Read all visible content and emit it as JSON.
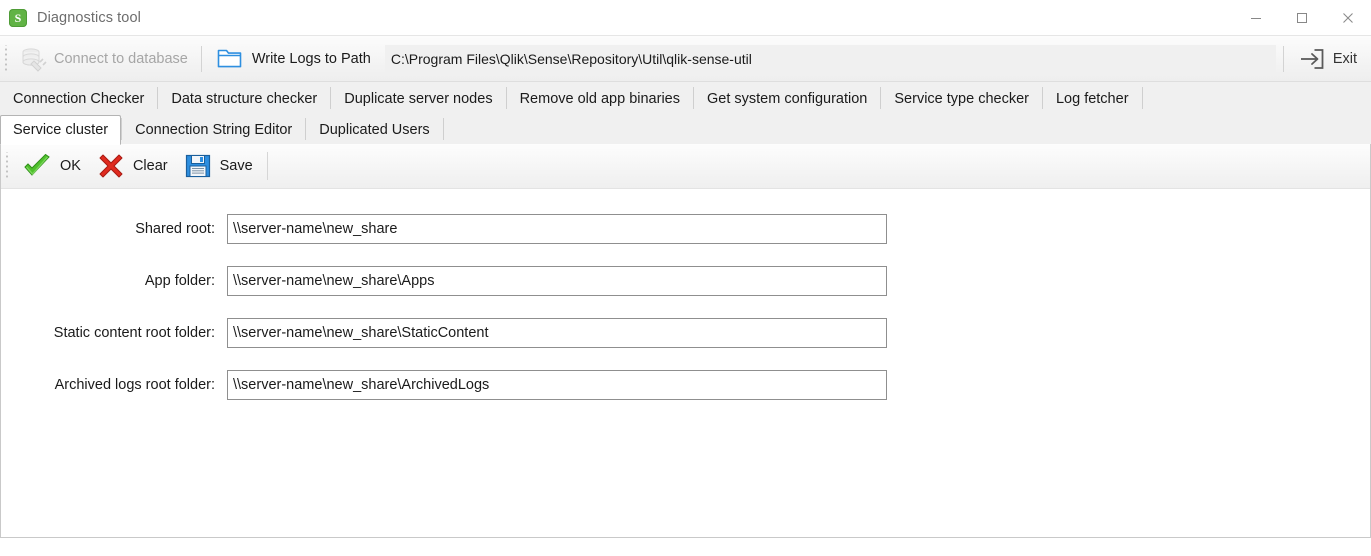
{
  "window": {
    "title": "Diagnostics tool",
    "app_icon": "qlik-sense-icon",
    "minimize_label": "Minimize",
    "maximize_label": "Maximize",
    "close_label": "Close",
    "accent_green": "#61b345",
    "accent_blue": "#1a8cff"
  },
  "toolbar": {
    "connect_label": "Connect to database",
    "connect_icon": "database-plug-icon",
    "connect_disabled": true,
    "write_logs_label": "Write Logs to Path",
    "write_logs_icon": "folder-icon",
    "path_value": "C:\\Program Files\\Qlik\\Sense\\Repository\\Util\\qlik-sense-util",
    "path_placeholder": "Path",
    "exit_label": "Exit",
    "exit_icon": "exit-door-icon"
  },
  "tabs_row1": [
    {
      "label": "Connection Checker",
      "active": false
    },
    {
      "label": "Data structure checker",
      "active": false
    },
    {
      "label": "Duplicate server nodes",
      "active": false
    },
    {
      "label": "Remove old app binaries",
      "active": false
    },
    {
      "label": "Get system configuration",
      "active": false
    },
    {
      "label": "Service type checker",
      "active": false
    },
    {
      "label": "Log fetcher",
      "active": false
    }
  ],
  "tabs_row2": [
    {
      "label": "Service cluster",
      "active": true
    },
    {
      "label": "Connection String Editor",
      "active": false
    },
    {
      "label": "Duplicated Users",
      "active": false
    }
  ],
  "actions": [
    {
      "label": "OK",
      "icon": "check-icon"
    },
    {
      "label": "Clear",
      "icon": "cross-icon"
    },
    {
      "label": "Save",
      "icon": "floppy-disk-icon"
    }
  ],
  "form": {
    "fields": [
      {
        "label": "Shared root:",
        "value": "\\\\server-name\\new_share",
        "placeholder": ""
      },
      {
        "label": "App folder:",
        "value": "\\\\server-name\\new_share\\Apps",
        "placeholder": ""
      },
      {
        "label": "Static content root folder:",
        "value": "\\\\server-name\\new_share\\StaticContent",
        "placeholder": ""
      },
      {
        "label": "Archived logs root folder:",
        "value": "\\\\server-name\\new_share\\ArchivedLogs",
        "placeholder": ""
      }
    ]
  }
}
